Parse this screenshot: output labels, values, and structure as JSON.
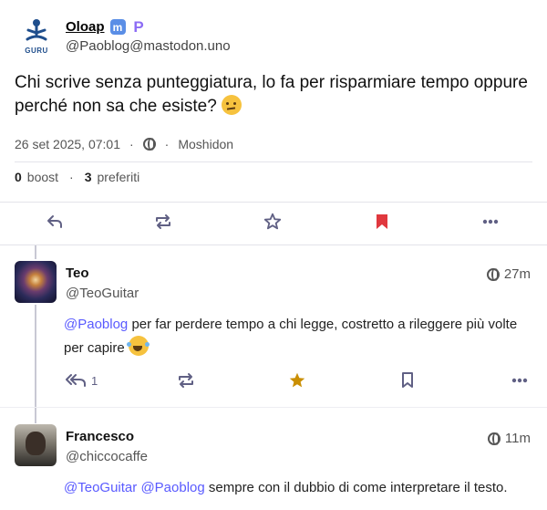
{
  "status": {
    "author": {
      "display_name": "Oloap",
      "handle": "@Paoblog@mastodon.uno",
      "avatar_text": "GURU",
      "badge_m": "m",
      "badge_p": "P"
    },
    "text": "Chi scrive senza punteggiatura, lo fa per risparmiare tempo oppure perché non sa che esiste?",
    "emoji": "thinking-face",
    "timestamp": "26 set 2025, 07:01",
    "sep1": "·",
    "sep2": "·",
    "app": "Moshidon",
    "boosts": "0",
    "boosts_label": "boost",
    "stats_sep": "·",
    "favourites": "3",
    "favourites_label": "preferiti"
  },
  "replies": [
    {
      "display_name": "Teo",
      "handle": "@TeoGuitar",
      "time": "27m",
      "mention": "@Paoblog",
      "text": " per far perdere tempo a chi legge, costretto a rileggere più volte per capire ",
      "emoji": "tears-of-joy",
      "reply_count": "1"
    },
    {
      "display_name": "Francesco",
      "handle": "@chiccocaffe",
      "time": "11m",
      "mention1": "@TeoGuitar",
      "mention2": "@Paoblog",
      "text": " sempre con il dubbio di come interpretare il testo."
    }
  ],
  "colors": {
    "accent": "#595aff",
    "bookmark_active": "#e0383e",
    "star_active": "#ca8f04",
    "icon": "#606084"
  }
}
